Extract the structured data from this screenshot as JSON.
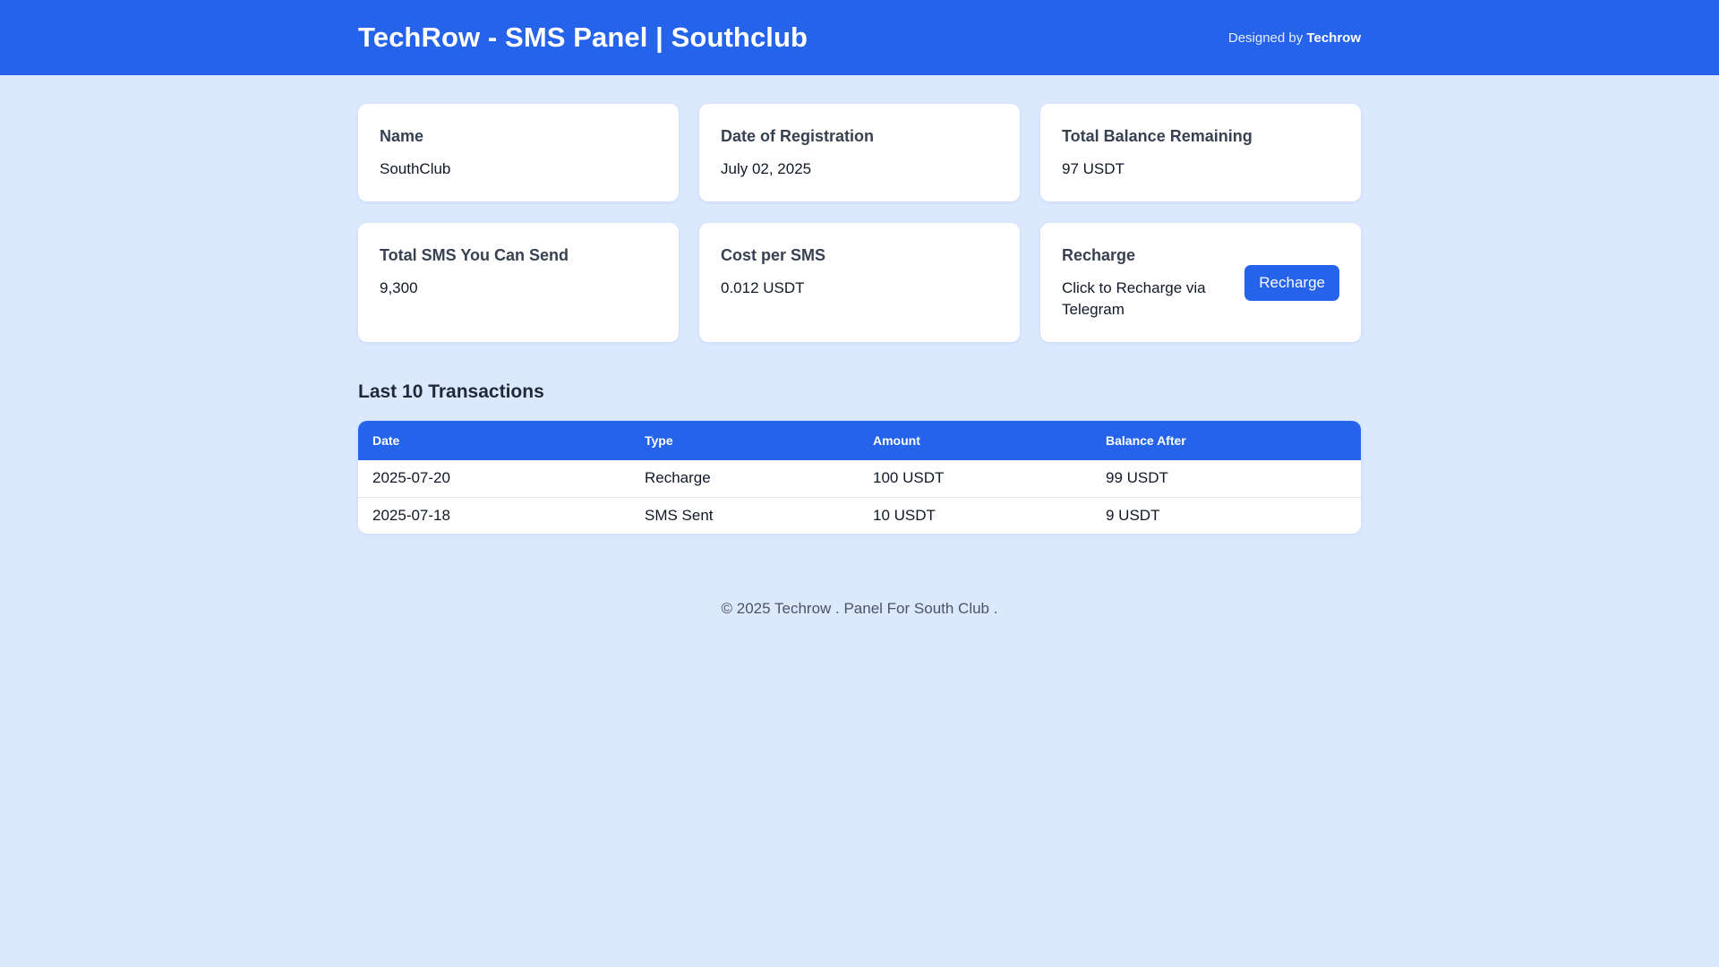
{
  "header": {
    "title": "TechRow - SMS Panel | Southclub",
    "designed_by_prefix": "Designed by",
    "designed_by_name": "Techrow",
    "brand_color": "#2563eb"
  },
  "cards": {
    "name": {
      "label": "Name",
      "value": "SouthClub"
    },
    "registration": {
      "label": "Date of Registration",
      "value": "July 02, 2025"
    },
    "balance": {
      "label": "Total Balance Remaining",
      "value": "97 USDT"
    },
    "sms_total": {
      "label": "Total SMS You Can Send",
      "value": "9,300"
    },
    "cost": {
      "label": "Cost per SMS",
      "value": "0.012 USDT"
    },
    "recharge": {
      "label": "Recharge",
      "description": "Click to Recharge via Telegram",
      "button_label": "Recharge"
    }
  },
  "transactions": {
    "title": "Last 10 Transactions",
    "columns": [
      "Date",
      "Type",
      "Amount",
      "Balance After"
    ],
    "rows": [
      {
        "date": "2025-07-20",
        "type": "Recharge",
        "amount": "100 USDT",
        "balance_after": "99 USDT"
      },
      {
        "date": "2025-07-18",
        "type": "SMS Sent",
        "amount": "10 USDT",
        "balance_after": "9 USDT"
      }
    ]
  },
  "footer": {
    "text": "© 2025 Techrow . Panel For South Club ."
  }
}
